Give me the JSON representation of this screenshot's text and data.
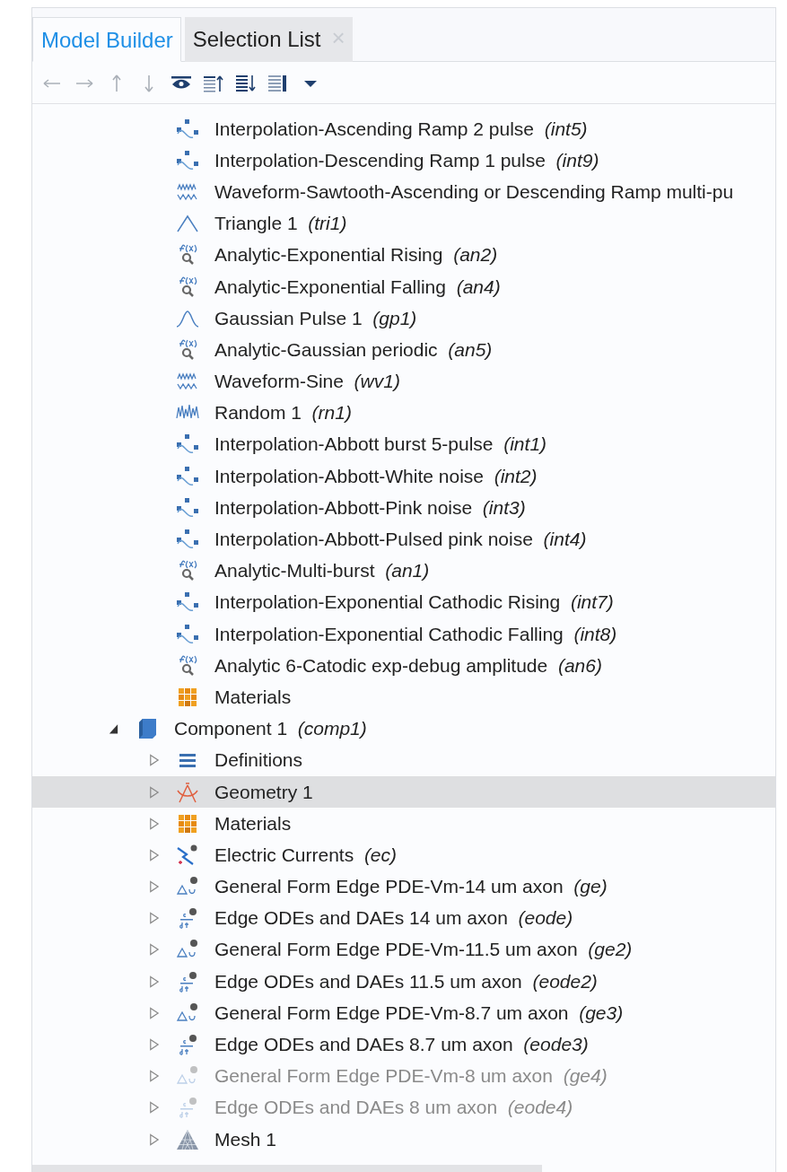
{
  "tabs": [
    {
      "label": "Model Builder",
      "selected": true
    },
    {
      "label": "Selection List",
      "selected": false,
      "close": "×"
    }
  ],
  "toolbar": [
    {
      "kind": "back",
      "disabled": true
    },
    {
      "kind": "forward",
      "disabled": true
    },
    {
      "kind": "up",
      "disabled": true
    },
    {
      "kind": "down",
      "disabled": true
    },
    {
      "kind": "show",
      "disabled": false
    },
    {
      "kind": "collapse",
      "disabled": false
    },
    {
      "kind": "expand",
      "disabled": false
    },
    {
      "kind": "options",
      "disabled": false
    },
    {
      "kind": "dropdown",
      "disabled": false
    }
  ],
  "global_items": [
    {
      "kind": "interpolation",
      "label": "Interpolation-Ascending Ramp 2 pulse",
      "tag": "(int5)"
    },
    {
      "kind": "interpolation",
      "label": "Interpolation-Descending Ramp 1 pulse",
      "tag": "(int9)"
    },
    {
      "kind": "waveform",
      "label": "Waveform-Sawtooth-Ascending or Descending Ramp multi-pu"
    },
    {
      "kind": "triangle",
      "label": "Triangle 1",
      "tag": "(tri1)"
    },
    {
      "kind": "analytic",
      "label": "Analytic-Exponential Rising",
      "tag": "(an2)"
    },
    {
      "kind": "analytic",
      "label": "Analytic-Exponential Falling",
      "tag": "(an4)"
    },
    {
      "kind": "gaussian",
      "label": "Gaussian Pulse 1",
      "tag": "(gp1)"
    },
    {
      "kind": "analytic",
      "label": "Analytic-Gaussian periodic",
      "tag": "(an5)"
    },
    {
      "kind": "waveform",
      "label": "Waveform-Sine",
      "tag": "(wv1)"
    },
    {
      "kind": "random",
      "label": "Random 1",
      "tag": "(rn1)"
    },
    {
      "kind": "interpolation",
      "label": "Interpolation-Abbott burst 5-pulse",
      "tag": "(int1)"
    },
    {
      "kind": "interpolation",
      "label": "Interpolation-Abbott-White noise",
      "tag": "(int2)"
    },
    {
      "kind": "interpolation",
      "label": "Interpolation-Abbott-Pink noise",
      "tag": "(int3)"
    },
    {
      "kind": "interpolation",
      "label": "Interpolation-Abbott-Pulsed pink noise",
      "tag": "(int4)"
    },
    {
      "kind": "analytic",
      "label": "Analytic-Multi-burst",
      "tag": "(an1)"
    },
    {
      "kind": "interpolation",
      "label": "Interpolation-Exponential Cathodic Rising",
      "tag": "(int7)"
    },
    {
      "kind": "interpolation",
      "label": "Interpolation-Exponential Cathodic Falling",
      "tag": "(int8)"
    },
    {
      "kind": "analytic",
      "label": "Analytic 6-Catodic exp-debug amplitude",
      "tag": "(an6)"
    },
    {
      "kind": "materials",
      "label": "Materials"
    }
  ],
  "tree": [
    {
      "kind": "component",
      "label": "Component 1",
      "tag": "(comp1)",
      "expanded": true,
      "selected": false,
      "disabled": false,
      "children": [
        {
          "kind": "definitions",
          "label": "Definitions",
          "expanded": false,
          "selected": false,
          "disabled": false
        },
        {
          "kind": "geometry",
          "label": "Geometry 1",
          "expanded": false,
          "selected": true,
          "disabled": false
        },
        {
          "kind": "materials",
          "label": "Materials",
          "expanded": false,
          "selected": false,
          "disabled": false
        },
        {
          "kind": "physics",
          "label": "Electric Currents",
          "tag": "(ec)",
          "expanded": false,
          "selected": false,
          "disabled": false
        },
        {
          "kind": "pde",
          "label": "General Form Edge PDE-Vm-14 um axon",
          "tag": "(ge)",
          "expanded": false,
          "selected": false,
          "disabled": false
        },
        {
          "kind": "ode",
          "label": "Edge ODEs and DAEs 14 um axon",
          "tag": "(eode)",
          "expanded": false,
          "selected": false,
          "disabled": false
        },
        {
          "kind": "pde",
          "label": "General Form Edge PDE-Vm-11.5 um axon",
          "tag": "(ge2)",
          "expanded": false,
          "selected": false,
          "disabled": false
        },
        {
          "kind": "ode",
          "label": "Edge ODEs and DAEs 11.5 um axon",
          "tag": "(eode2)",
          "expanded": false,
          "selected": false,
          "disabled": false
        },
        {
          "kind": "pde",
          "label": "General Form Edge PDE-Vm-8.7 um axon",
          "tag": "(ge3)",
          "expanded": false,
          "selected": false,
          "disabled": false
        },
        {
          "kind": "ode",
          "label": "Edge ODEs and DAEs 8.7 um axon",
          "tag": "(eode3)",
          "expanded": false,
          "selected": false,
          "disabled": false
        },
        {
          "kind": "pde",
          "label": "General Form Edge PDE-Vm-8 um axon",
          "tag": "(ge4)",
          "expanded": false,
          "selected": false,
          "disabled": true
        },
        {
          "kind": "ode",
          "label": "Edge ODEs and DAEs 8 um axon",
          "tag": "(eode4)",
          "expanded": false,
          "selected": false,
          "disabled": true
        },
        {
          "kind": "mesh",
          "label": "Mesh 1",
          "expanded": false,
          "selected": false,
          "disabled": false
        }
      ]
    }
  ]
}
